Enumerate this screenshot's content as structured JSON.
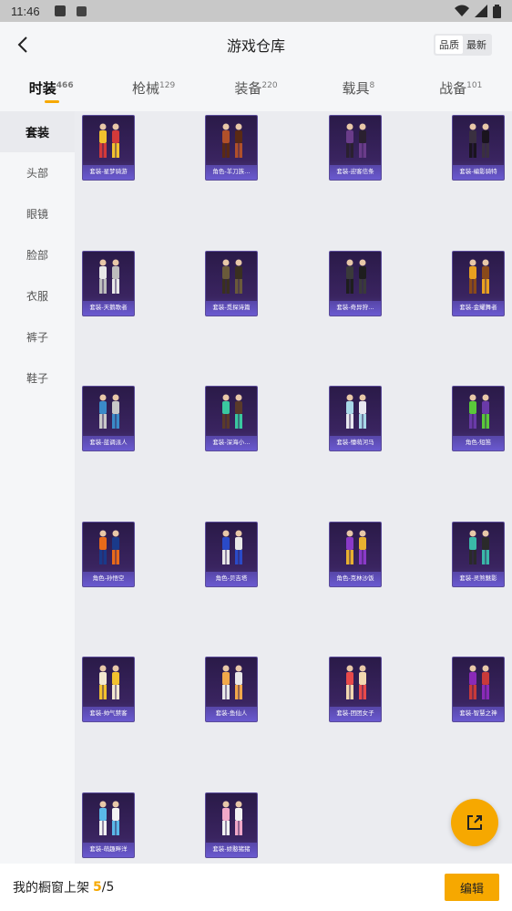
{
  "status": {
    "time": "11:46"
  },
  "header": {
    "title": "游戏仓库",
    "seg": [
      "品质",
      "最新"
    ],
    "seg_active": 0
  },
  "tabs": [
    {
      "label": "时装",
      "count": "466"
    },
    {
      "label": "枪械",
      "count": "129"
    },
    {
      "label": "装备",
      "count": "220"
    },
    {
      "label": "载具",
      "count": "8"
    },
    {
      "label": "战备",
      "count": "101"
    }
  ],
  "active_tab": 0,
  "side": [
    "套装",
    "头部",
    "眼镜",
    "脸部",
    "衣服",
    "裤子",
    "鞋子"
  ],
  "active_side": 0,
  "items": [
    {
      "label": "套装-星梦骑游",
      "c1": "#f2c12e",
      "c2": "#d23a3a"
    },
    {
      "label": "角色-羊刀族…",
      "c1": "#b0502a",
      "c2": "#5a2a14"
    },
    {
      "label": "套装-迎客信条",
      "c1": "#6a3c8a",
      "c2": "#2a2030"
    },
    {
      "label": "套装-编影骑特",
      "c1": "#3a3040",
      "c2": "#1a141e"
    },
    {
      "label": "套装-天鹅歌者",
      "c1": "#e8e8e8",
      "c2": "#bdbdbd"
    },
    {
      "label": "套装-觅探诗篇",
      "c1": "#6a5a3a",
      "c2": "#3a3020"
    },
    {
      "label": "套装-奇异狩…",
      "c1": "#3a3a3a",
      "c2": "#1e1e1e"
    },
    {
      "label": "套装-金耀舞者",
      "c1": "#e8a020",
      "c2": "#8a4a1a"
    },
    {
      "label": "套装-蓝调派人",
      "c1": "#3a8ac8",
      "c2": "#c8c8c8"
    },
    {
      "label": "套装-深海小…",
      "c1": "#3ac8a0",
      "c2": "#5a3a2a"
    },
    {
      "label": "套装-懵萌河马",
      "c1": "#a8d8e8",
      "c2": "#e8e8f0"
    },
    {
      "label": "角色-短笛",
      "c1": "#5ac83a",
      "c2": "#6a3aa8"
    },
    {
      "label": "角色-孙悟空",
      "c1": "#e86a1a",
      "c2": "#1a3a8a"
    },
    {
      "label": "角色-贝吉塔",
      "c1": "#2a4ac8",
      "c2": "#e8e8e8"
    },
    {
      "label": "角色-克林沙饭",
      "c1": "#8a3ac8",
      "c2": "#e8b030"
    },
    {
      "label": "套装-灵煞魅影",
      "c1": "#3ab8a8",
      "c2": "#2a2a2a"
    },
    {
      "label": "套装-帅气禁客",
      "c1": "#f2e8d0",
      "c2": "#f2c12e"
    },
    {
      "label": "套装-鱼仙人",
      "c1": "#f2a84a",
      "c2": "#e8e8e8"
    },
    {
      "label": "套装-团团女子",
      "c1": "#e84a4a",
      "c2": "#f2d8b0"
    },
    {
      "label": "套装-智慧之神",
      "c1": "#8a2ab8",
      "c2": "#c83a3a"
    },
    {
      "label": "套装-萌趣畔洋",
      "c1": "#5ab8e8",
      "c2": "#f2f2f2"
    },
    {
      "label": "套装-娇憨猪猪",
      "c1": "#f2a8c8",
      "c2": "#f2f2f2"
    }
  ],
  "bottom": {
    "text": "我的橱窗上架",
    "count": "5",
    "sep": "/",
    "total": "5",
    "edit": "编辑"
  }
}
